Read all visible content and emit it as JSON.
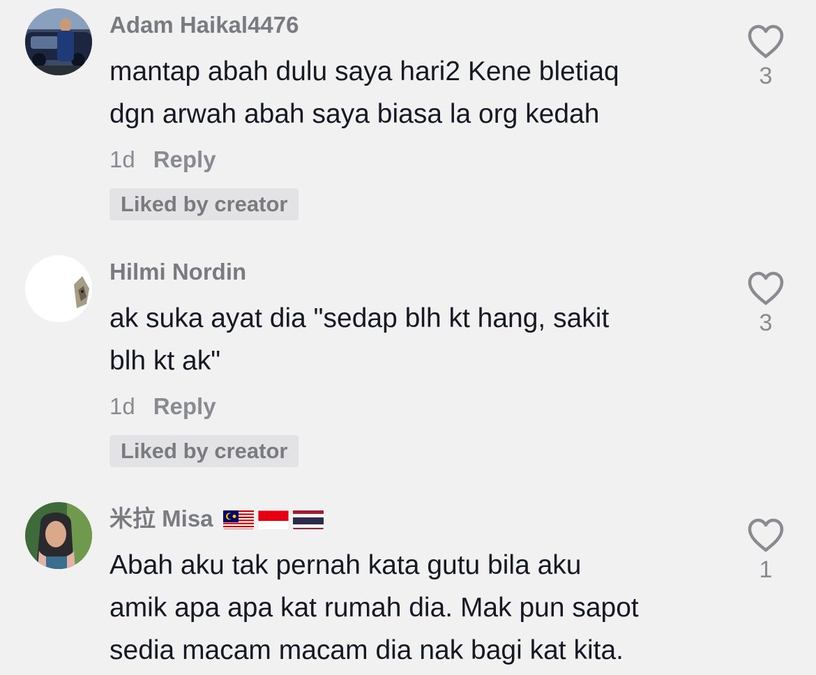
{
  "comments": [
    {
      "username": "Adam Haikal4476",
      "text_lines": [
        "mantap abah dulu saya hari2 Kene bletiaq",
        "dgn arwah abah saya biasa la org kedah"
      ],
      "time": "1d",
      "reply_label": "Reply",
      "badge": "Liked by creator",
      "likes": "3",
      "avatar": "car-photo-avatar"
    },
    {
      "username": "Hilmi Nordin",
      "text_lines": [
        "ak suka ayat dia \"sedap blh kt hang, sakit",
        "blh kt ak\""
      ],
      "time": "1d",
      "reply_label": "Reply",
      "badge": "Liked by creator",
      "likes": "3",
      "avatar": "white-cat-avatar"
    },
    {
      "username": "米拉 Misa",
      "flags": [
        "malaysia-flag",
        "indonesia-flag",
        "thailand-flag"
      ],
      "text_lines": [
        "Abah aku tak pernah kata gutu bila aku",
        "amik apa apa kat rumah dia. Mak pun sapot",
        "sedia macam macam dia nak bagi kat kita."
      ],
      "likes": "1",
      "avatar": "woman-hijab-avatar"
    }
  ],
  "colors": {
    "background": "#f1f1f2",
    "username": "#7a7b80",
    "text": "#161823",
    "muted": "#8a8b91",
    "badge_bg": "#e3e3e5"
  }
}
